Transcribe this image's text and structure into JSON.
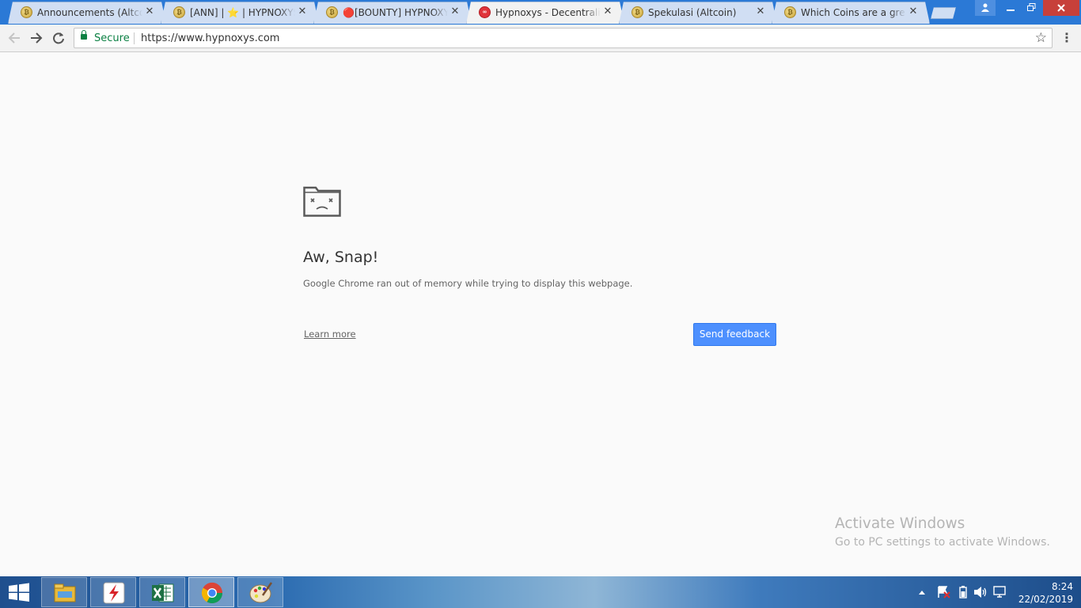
{
  "browser": {
    "tabs": [
      {
        "title": "Announcements (Altcoins)",
        "favicon": "bitcoin-favicon",
        "active": false
      },
      {
        "title": "[ANN] | ⭐ | HYPNOXYS - Decentralizing",
        "favicon": "bitcoin-favicon",
        "active": false
      },
      {
        "title": "🔴[BOUNTY] HYPNOXYS",
        "favicon": "bitcoin-favicon",
        "active": false
      },
      {
        "title": "Hypnoxys - Decentralizing",
        "favicon": "hypnoxys-favicon",
        "active": true
      },
      {
        "title": "Spekulasi (Altcoin)",
        "favicon": "bitcoin-favicon",
        "active": false
      },
      {
        "title": "Which Coins are a great buy",
        "favicon": "bitcoin-favicon",
        "active": false
      }
    ],
    "close_glyph": "✕",
    "security_label": "Secure",
    "url": "https://www.hypnoxys.com"
  },
  "error_page": {
    "heading": "Aw, Snap!",
    "message": "Google Chrome ran out of memory while trying to display this webpage.",
    "learn_more": "Learn more",
    "send_feedback": "Send feedback"
  },
  "watermark": {
    "title": "Activate Windows",
    "subtitle": "Go to PC settings to activate Windows."
  },
  "taskbar": {
    "apps": [
      {
        "name": "file-explorer-icon",
        "active": false
      },
      {
        "name": "flashget-icon",
        "active": false
      },
      {
        "name": "excel-icon",
        "active": false
      },
      {
        "name": "chrome-icon",
        "active": true
      },
      {
        "name": "paint-icon",
        "active": false
      }
    ],
    "time": "8:24",
    "date": "22/02/2019"
  },
  "colors": {
    "accent_button": "#4d90fe",
    "secure_green": "#0b8043",
    "titlebar": "#2b79d6"
  }
}
